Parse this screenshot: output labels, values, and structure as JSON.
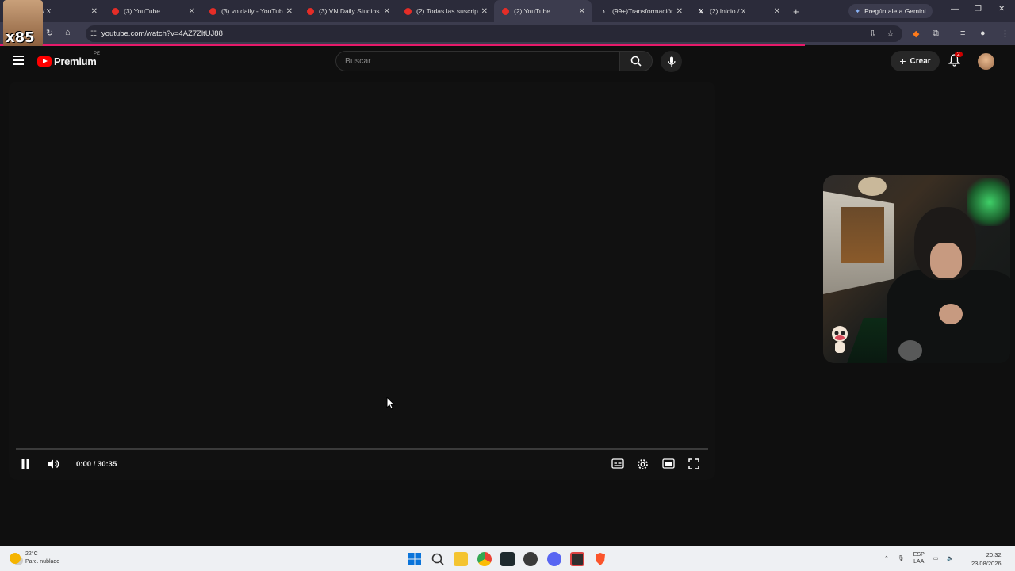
{
  "browser": {
    "tabs": [
      {
        "title": "nicio / X",
        "icon": "x-icon",
        "active": false
      },
      {
        "title": "(3) YouTube",
        "icon": "youtube-icon",
        "active": false
      },
      {
        "title": "(3) vn daily - YouTube",
        "icon": "youtube-icon",
        "active": false
      },
      {
        "title": "(3) VN Daily Studios",
        "icon": "youtube-icon",
        "active": false
      },
      {
        "title": "(2) Todas las suscripc",
        "icon": "youtube-icon",
        "active": false
      },
      {
        "title": "(2) YouTube",
        "icon": "youtube-icon",
        "active": true
      },
      {
        "title": "(99+)Transformación",
        "icon": "tiktok-icon",
        "active": false
      },
      {
        "title": "(2) Inicio / X",
        "icon": "x-icon",
        "active": false
      }
    ],
    "new_tab_label": "+",
    "gemini_label": "Pregúntale a Gemini",
    "url": "youtube.com/watch?v=4AZ7ZltUJ88",
    "accent_color": "#e61a6a"
  },
  "overlay": {
    "streamer_tag": "x85"
  },
  "youtube": {
    "logo_text": "Premium",
    "country_code": "PE",
    "search_placeholder": "Buscar",
    "create_label": "Crear",
    "notification_count": "2"
  },
  "player": {
    "time_display": "0:00 / 30:35",
    "progress": 0,
    "state": "playing"
  },
  "taskbar": {
    "temperature": "22°C",
    "weather": "Parc. nublado",
    "language_primary": "ESP",
    "language_secondary": "LAA",
    "time": "20:32",
    "date": "23/08/2026"
  }
}
